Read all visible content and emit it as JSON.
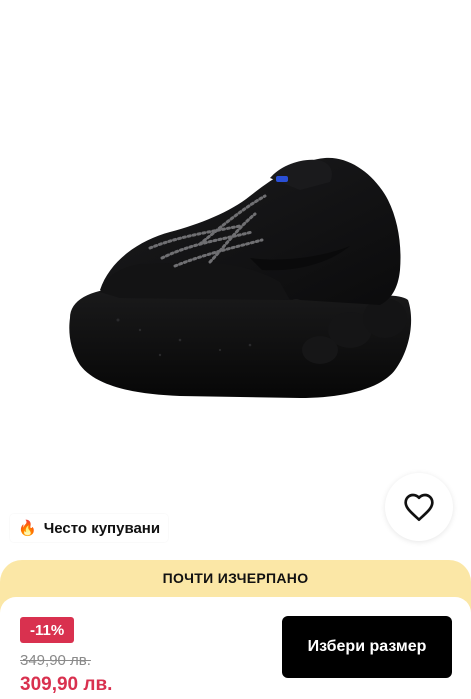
{
  "product": {
    "image_subject": "black running sneaker with bungee laces",
    "wishlist_icon": "heart-outline-icon"
  },
  "badges": {
    "popular_icon": "🔥",
    "popular_label": "Често купувани"
  },
  "stock_banner": {
    "text": "ПОЧТИ ИЗЧЕРПАНО",
    "color": "#fbe7a6"
  },
  "pricing": {
    "discount": "-11%",
    "old_price": "349,90 лв.",
    "new_price": "309,90 лв.",
    "accent_color": "#d9314f"
  },
  "actions": {
    "select_size_label": "Избери размер"
  }
}
